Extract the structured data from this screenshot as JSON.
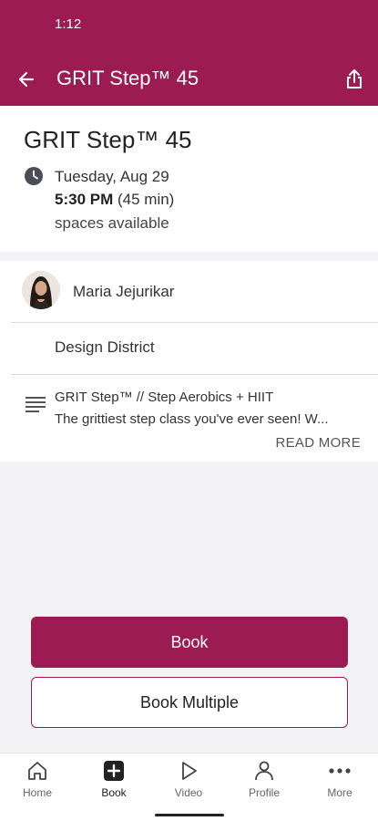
{
  "status_bar": {
    "time": "1:12"
  },
  "app_bar": {
    "title": "GRIT Step™ 45"
  },
  "class_info": {
    "title": "GRIT Step™ 45",
    "date": "Tuesday, Aug 29",
    "time": "5:30 PM",
    "duration": "(45 min)",
    "availability": "spaces available"
  },
  "instructor": {
    "name": "Maria Jejurikar"
  },
  "location": {
    "name": "Design District"
  },
  "description": {
    "title": "GRIT Step™ // Step Aerobics + HIIT",
    "body": "The grittiest step class you've ever seen!  W...",
    "read_more": "READ MORE"
  },
  "actions": {
    "book_label": "Book",
    "book_multiple_label": "Book Multiple"
  },
  "bottom_nav": {
    "items": [
      {
        "label": "Home",
        "icon": "home-icon"
      },
      {
        "label": "Book",
        "icon": "book-plus-icon"
      },
      {
        "label": "Video",
        "icon": "play-icon"
      },
      {
        "label": "Profile",
        "icon": "profile-icon"
      },
      {
        "label": "More",
        "icon": "more-icon"
      }
    ],
    "active": "Book"
  },
  "colors": {
    "brand": "#9b1b52"
  }
}
